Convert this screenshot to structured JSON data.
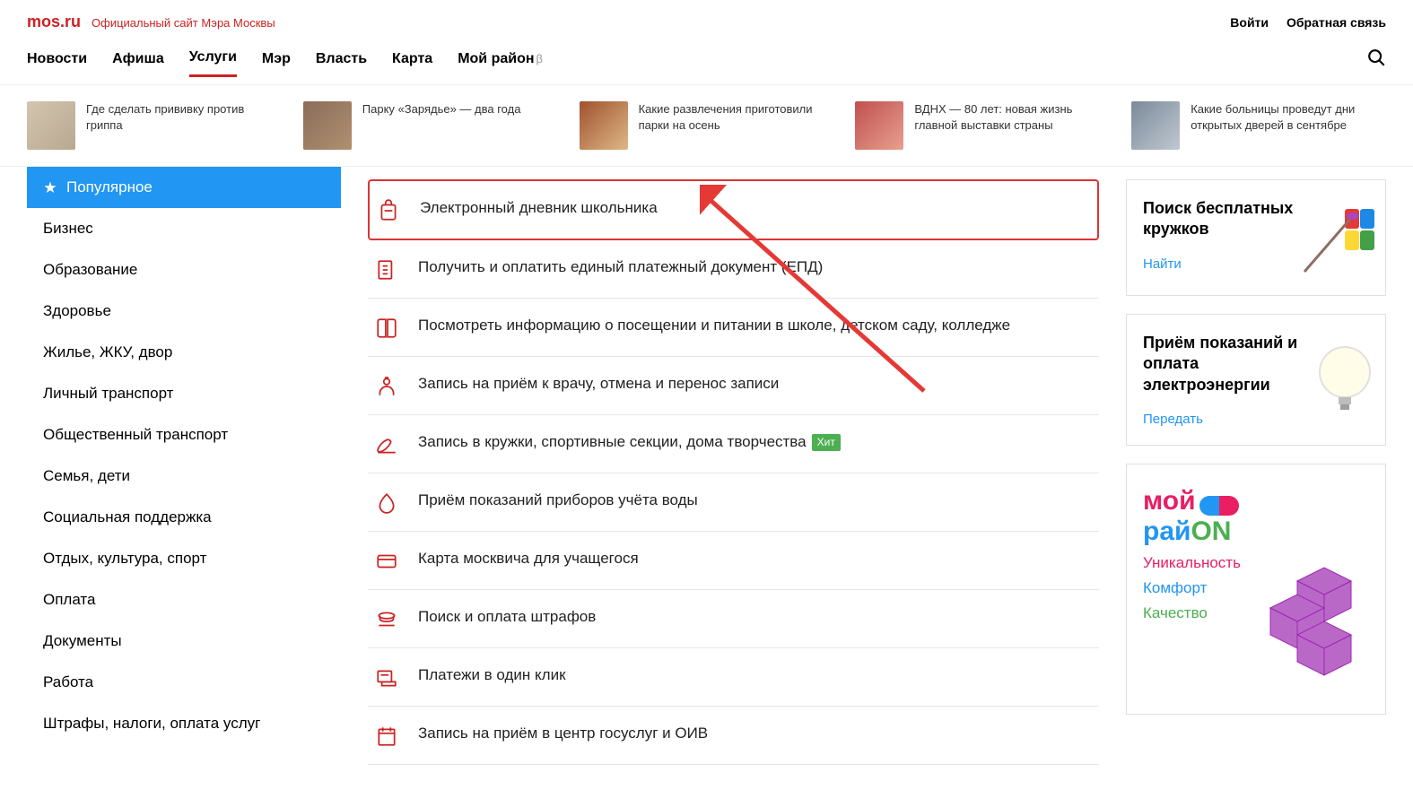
{
  "header": {
    "logo": "mos.ru",
    "tagline": "Официальный сайт Мэра Москвы",
    "login": "Войти",
    "feedback": "Обратная связь"
  },
  "nav": {
    "items": [
      "Новости",
      "Афиша",
      "Услуги",
      "Мэр",
      "Власть",
      "Карта",
      "Мой район"
    ],
    "beta": "β"
  },
  "news": [
    {
      "text": "Где сделать прививку против гриппа"
    },
    {
      "text": "Парку «Зарядье» — два года"
    },
    {
      "text": "Какие развлечения приготовили парки на осень"
    },
    {
      "text": "ВДНХ — 80 лет: новая жизнь главной выставки страны"
    },
    {
      "text": "Какие больницы проведут дни открытых дверей в сентябре"
    }
  ],
  "sidebar": {
    "items": [
      "Популярное",
      "Бизнес",
      "Образование",
      "Здоровье",
      "Жилье, ЖКУ, двор",
      "Личный транспорт",
      "Общественный транспорт",
      "Семья, дети",
      "Социальная поддержка",
      "Отдых, культура, спорт",
      "Оплата",
      "Документы",
      "Работа",
      "Штрафы, налоги, оплата услуг"
    ]
  },
  "services": [
    {
      "title": "Электронный дневник школьника",
      "highlighted": true
    },
    {
      "title": "Получить и оплатить единый платежный документ (ЕПД)"
    },
    {
      "title": "Посмотреть информацию о посещении и питании в школе, детском саду, колледже"
    },
    {
      "title": "Запись на приём к врачу, отмена и перенос записи"
    },
    {
      "title": "Запись в кружки, спортивные секции, дома творчества",
      "badge": "Хит"
    },
    {
      "title": "Приём показаний приборов учёта воды"
    },
    {
      "title": "Карта москвича для учащегося"
    },
    {
      "title": "Поиск и оплата штрафов"
    },
    {
      "title": "Платежи в один клик"
    },
    {
      "title": "Запись на приём в центр госуслуг и ОИВ"
    }
  ],
  "promos": [
    {
      "title": "Поиск бесплатных кружков",
      "link": "Найти"
    },
    {
      "title": "Приём показаний и оплата электроэнергии",
      "link": "Передать"
    }
  ],
  "district": {
    "moi": "мой",
    "rai": "рай",
    "on": "ON",
    "tags": [
      "Уникальность",
      "Комфорт",
      "Качество"
    ]
  }
}
